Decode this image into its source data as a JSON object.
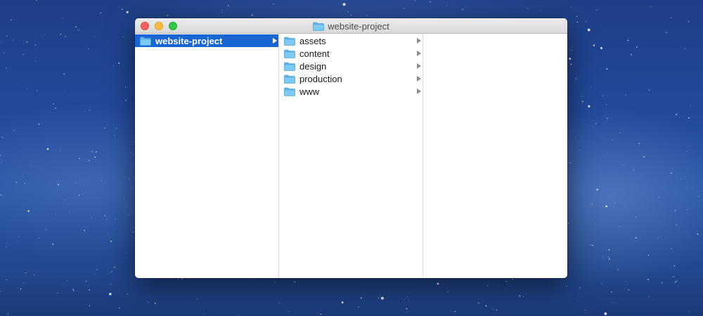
{
  "window": {
    "title": "website-project",
    "title_icon": "folder-icon"
  },
  "columns": [
    {
      "items": [
        {
          "label": "website-project",
          "icon": "folder-icon",
          "selected": true,
          "has_children": true
        }
      ]
    },
    {
      "items": [
        {
          "label": "assets",
          "icon": "folder-icon",
          "has_children": true
        },
        {
          "label": "content",
          "icon": "folder-icon",
          "has_children": true
        },
        {
          "label": "design",
          "icon": "folder-icon",
          "has_children": true
        },
        {
          "label": "production",
          "icon": "folder-icon",
          "has_children": true
        },
        {
          "label": "www",
          "icon": "folder-icon",
          "has_children": true
        }
      ]
    },
    {
      "items": []
    }
  ],
  "colors": {
    "selection": "#1766d4",
    "folder": "#6ec3f4",
    "close": "#fc605c",
    "minimize": "#fdbc40",
    "maximize": "#34c84a"
  }
}
